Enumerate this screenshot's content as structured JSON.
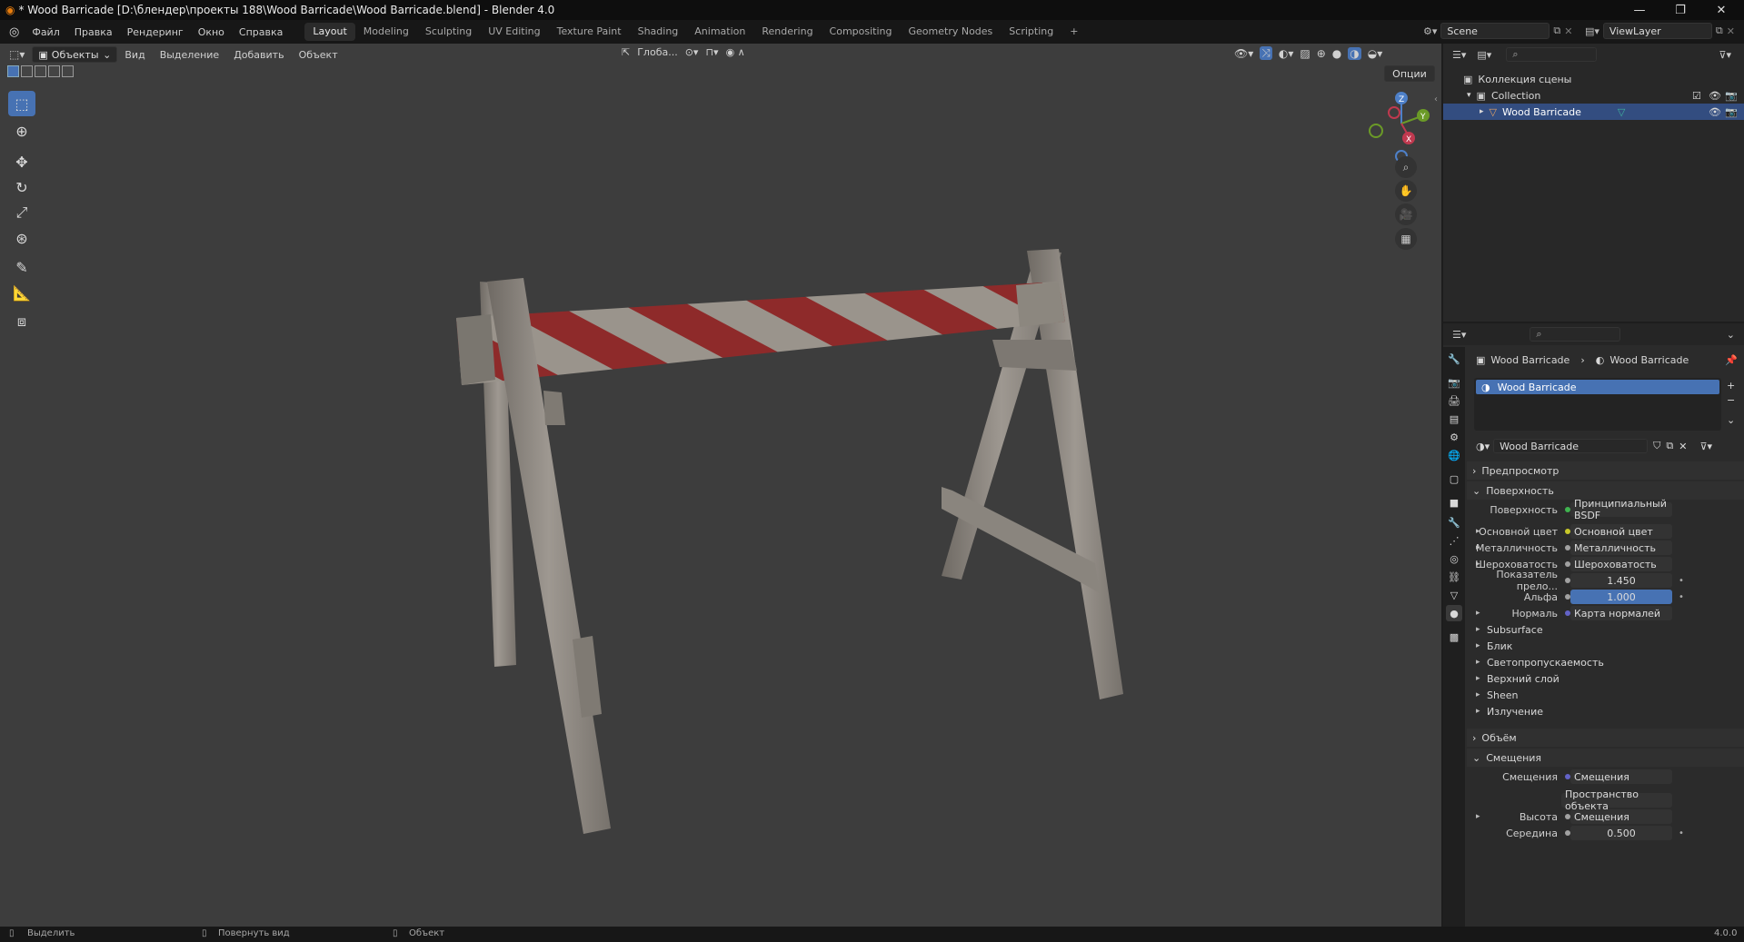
{
  "window": {
    "title": "* Wood Barricade [D:\\блендер\\проекты 188\\Wood Barricade\\Wood Barricade.blend] - Blender 4.0",
    "controls": [
      "—",
      "❐",
      "✕"
    ]
  },
  "topbar": {
    "menus": [
      "Файл",
      "Правка",
      "Рендеринг",
      "Окно",
      "Справка"
    ],
    "workspaces": [
      "Layout",
      "Modeling",
      "Sculpting",
      "UV Editing",
      "Texture Paint",
      "Shading",
      "Animation",
      "Rendering",
      "Compositing",
      "Geometry Nodes",
      "Scripting"
    ],
    "active_workspace": "Layout",
    "add_tab": "+",
    "scene": "Scene",
    "view_layer": "ViewLayer"
  },
  "viewport": {
    "mode": "Объекты",
    "menus": [
      "Вид",
      "Выделение",
      "Добавить",
      "Объект"
    ],
    "transform_orientation": "Глоба...",
    "options": "Опции",
    "gizmo": {
      "x": "X",
      "y": "Y",
      "z": "Z"
    },
    "background_color": "#3d3d3d"
  },
  "outliner": {
    "items": [
      {
        "label": "Коллекция сцены",
        "level": 0
      },
      {
        "label": "Collection",
        "level": 1
      },
      {
        "label": "Wood Barricade",
        "level": 2,
        "selected": true
      }
    ]
  },
  "properties": {
    "breadcrumb": [
      "Wood Barricade",
      "Wood Barricade"
    ],
    "material_slot": "Wood Barricade",
    "material_name": "Wood Barricade",
    "sections": {
      "preview": "Предпросмотр",
      "surface": "Поверхность",
      "volume": "Объём",
      "displacement": "Смещения"
    },
    "surface_rows": [
      {
        "label": "Поверхность",
        "value": "Принципиальный BSDF",
        "dot": "#3fb34f"
      },
      {
        "label": "Основной цвет",
        "value": "Основной цвет",
        "dot": "#c7c729",
        "expand": true
      },
      {
        "label": "Металличность",
        "value": "Металличность",
        "dot": "#a1a1a1",
        "expand": true
      },
      {
        "label": "Шероховатость",
        "value": "Шероховатость",
        "dot": "#a1a1a1",
        "expand": true
      },
      {
        "label": "Показатель прело...",
        "value": "1.450",
        "dot": "#a1a1a1",
        "numeric": true
      },
      {
        "label": "Альфа",
        "value": "1.000",
        "dot": "#a1a1a1",
        "numeric": true,
        "highlight": true
      },
      {
        "label": "Нормаль",
        "value": "Карта нормалей",
        "dot": "#6363c7",
        "expand": true
      }
    ],
    "subpanels": [
      "Subsurface",
      "Блик",
      "Светопропускаемость",
      "Верхний слой",
      "Sheen",
      "Излучение"
    ],
    "displacement_rows": [
      {
        "label": "Смещения",
        "value": "Смещения",
        "dot": "#6363c7"
      },
      {
        "label": "",
        "value": "Пространство объекта"
      },
      {
        "label": "Высота",
        "value": "Смещения",
        "dot": "#a1a1a1",
        "expand": true
      },
      {
        "label": "Середина",
        "value": "0.500",
        "dot": "#a1a1a1",
        "numeric": true
      }
    ]
  },
  "statusbar": {
    "items": [
      "Выделить",
      "Повернуть вид",
      "Объект"
    ],
    "version": "4.0.0"
  },
  "colors": {
    "accent": "#4772b3",
    "stripe_red": "#8e2a2a",
    "wood": "#8f8a84"
  }
}
